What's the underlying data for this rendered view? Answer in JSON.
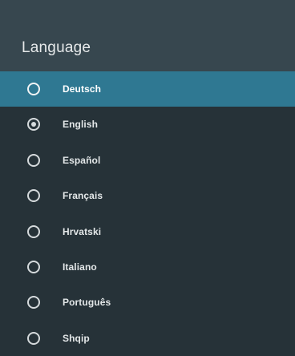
{
  "header": {
    "title": "Language"
  },
  "languages": [
    {
      "label": "Deutsch",
      "selected": false,
      "focused": true
    },
    {
      "label": "English",
      "selected": true,
      "focused": false
    },
    {
      "label": "Español",
      "selected": false,
      "focused": false
    },
    {
      "label": "Français",
      "selected": false,
      "focused": false
    },
    {
      "label": "Hrvatski",
      "selected": false,
      "focused": false
    },
    {
      "label": "Italiano",
      "selected": false,
      "focused": false
    },
    {
      "label": "Português",
      "selected": false,
      "focused": false
    },
    {
      "label": "Shqip",
      "selected": false,
      "focused": false
    }
  ],
  "colors": {
    "background": "#263238",
    "header_background": "#37474f",
    "focus_highlight": "#2f7892",
    "text": "#e3e7e8"
  }
}
